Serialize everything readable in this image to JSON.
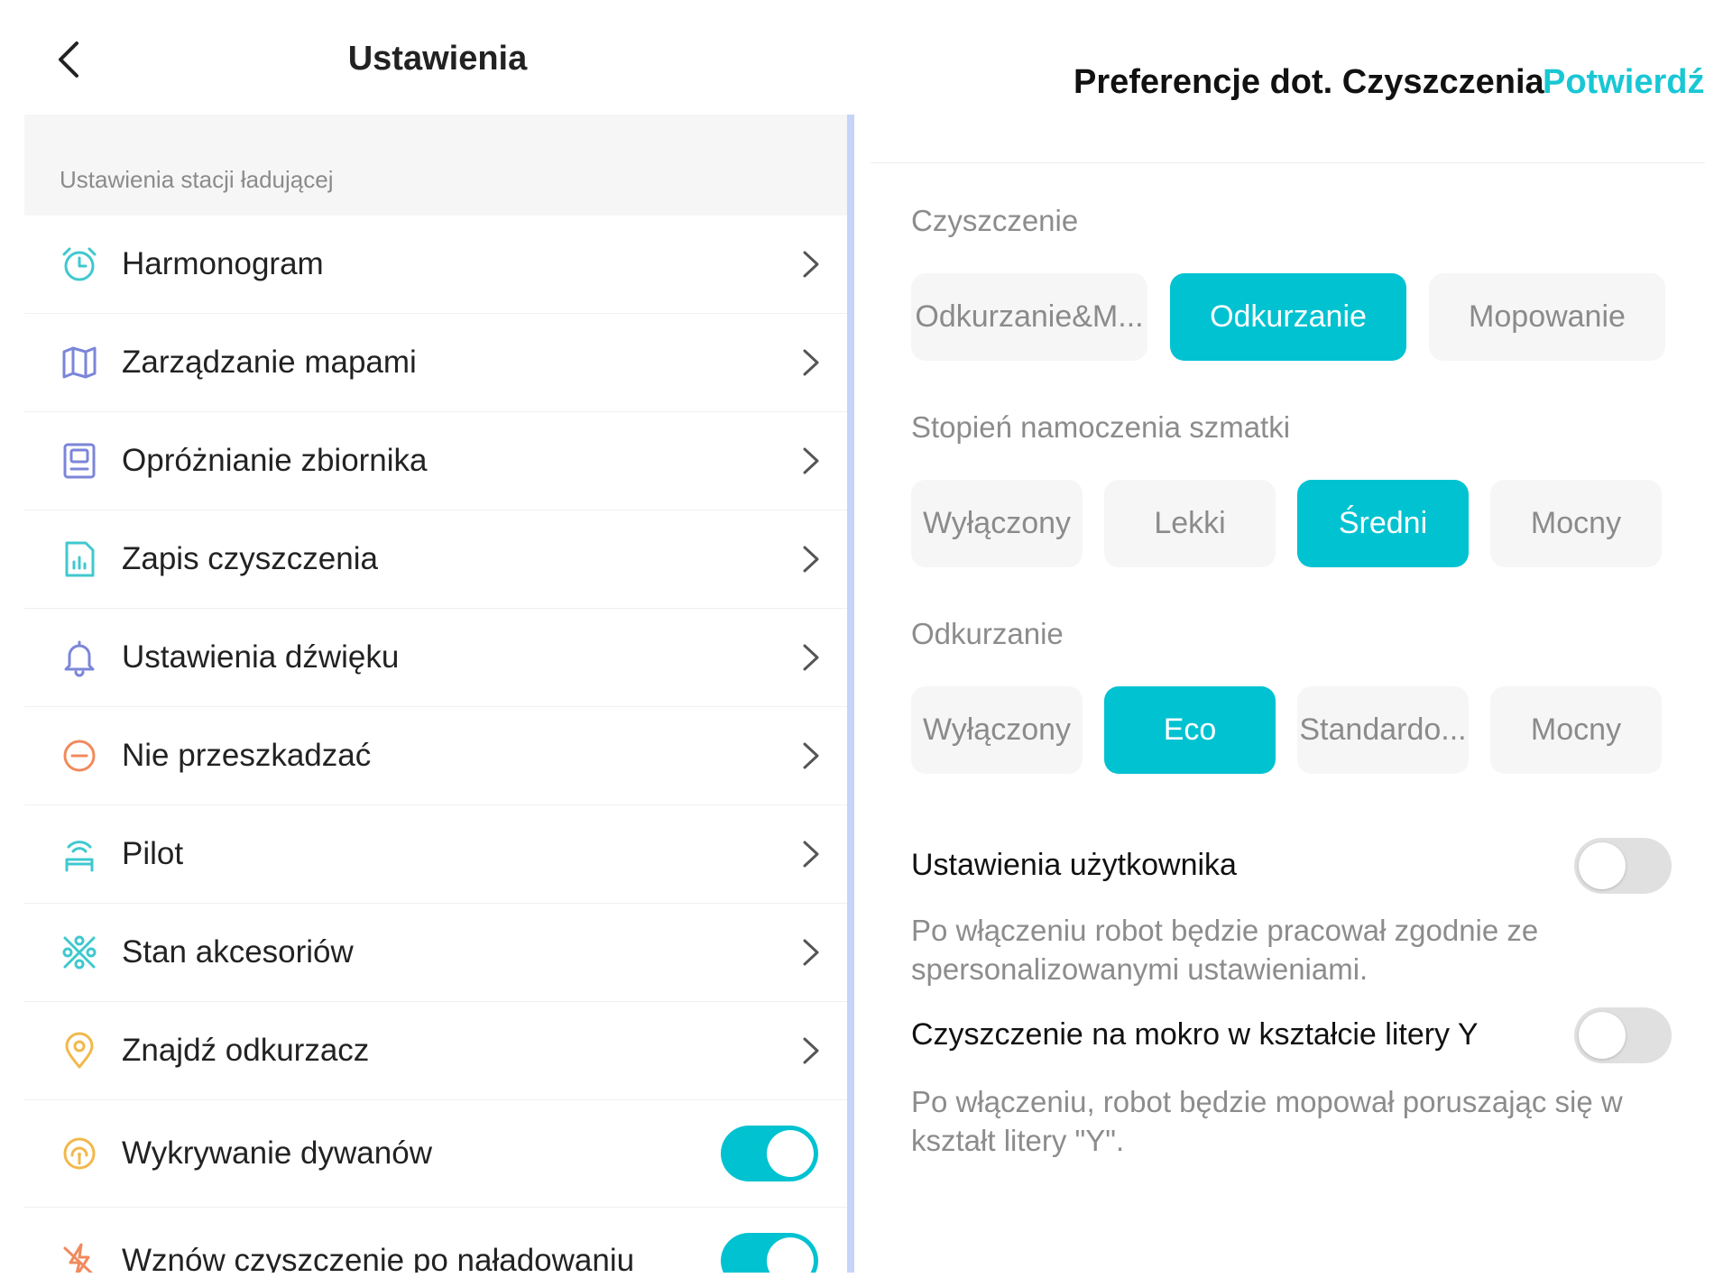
{
  "left": {
    "title": "Ustawienia",
    "section_label": "Ustawienia stacji ładującej",
    "items": [
      {
        "label": "Harmonogram",
        "icon": "alarm-clock-icon",
        "color": "#3fc8cf",
        "control": "chevron"
      },
      {
        "label": "Zarządzanie mapami",
        "icon": "map-icon",
        "color": "#7b86d9",
        "control": "chevron"
      },
      {
        "label": "Opróżnianie zbiornika",
        "icon": "dustbin-icon",
        "color": "#7b86d9",
        "control": "chevron"
      },
      {
        "label": "Zapis czyszczenia",
        "icon": "report-chart-icon",
        "color": "#3fc8cf",
        "control": "chevron"
      },
      {
        "label": "Ustawienia dźwięku",
        "icon": "bell-icon",
        "color": "#7b86d9",
        "control": "chevron"
      },
      {
        "label": "Nie przeszkadzać",
        "icon": "do-not-disturb-icon",
        "color": "#f08a5d",
        "control": "chevron"
      },
      {
        "label": "Pilot",
        "icon": "remote-control-icon",
        "color": "#3fc8cf",
        "control": "chevron"
      },
      {
        "label": "Stan akcesoriów",
        "icon": "accessories-icon",
        "color": "#3fc8cf",
        "control": "chevron"
      },
      {
        "label": "Znajdź odkurzacz",
        "icon": "location-pin-icon",
        "color": "#f2b84b",
        "control": "chevron"
      },
      {
        "label": "Wykrywanie dywanów",
        "icon": "carpet-detection-icon",
        "color": "#f2b84b",
        "control": "toggle",
        "on": true
      },
      {
        "label": "Wznów czyszczenie po naładowaniu",
        "icon": "charge-resume-icon",
        "color": "#f08a5d",
        "control": "toggle",
        "on": true
      }
    ],
    "toggle_on_color": "#00c2d1"
  },
  "right": {
    "title": "Preferencje dot. Czyszczenia",
    "confirm": "Potwierdź",
    "groups": [
      {
        "label": "Czyszczenie",
        "options": [
          "Odkurzanie&M...",
          "Odkurzanie",
          "Mopowanie"
        ],
        "selected": 1
      },
      {
        "label": "Stopień namoczenia szmatki",
        "options": [
          "Wyłączony",
          "Lekki",
          "Średni",
          "Mocny"
        ],
        "selected": 2
      },
      {
        "label": "Odkurzanie",
        "options": [
          "Wyłączony",
          "Eco",
          "Standardo...",
          "Mocny"
        ],
        "selected": 1
      }
    ],
    "user_settings": {
      "title": "Ustawienia użytkownika",
      "on": false,
      "desc": "Po włączeniu robot będzie pracował zgodnie ze spersonalizowanymi ustawieniami."
    },
    "y_mop": {
      "title": "Czyszczenie na mokro w kształcie litery Y",
      "on": false,
      "desc": "Po włączeniu, robot będzie mopował poruszając się w kształt litery \"Y\"."
    },
    "accent_color": "#00c2d1"
  }
}
